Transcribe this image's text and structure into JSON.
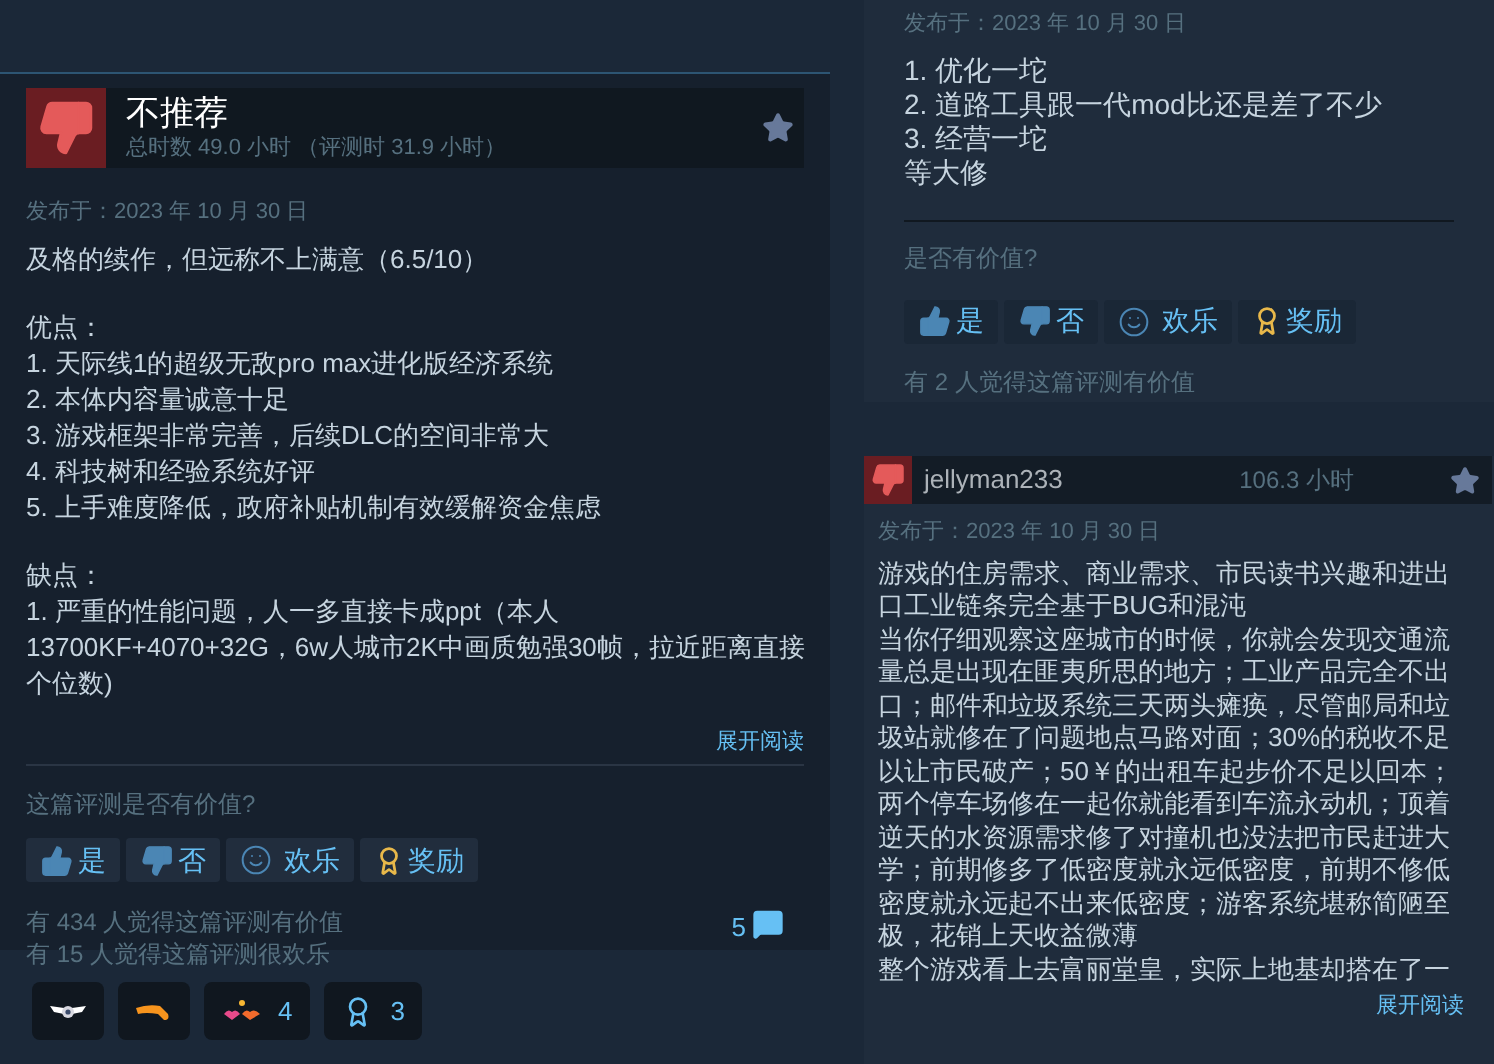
{
  "left_review": {
    "recommended": false,
    "title": "不推荐",
    "playtime": "总时数 49.0 小时 （评测时 31.9 小时）",
    "posted": "发布于：2023 年 10 月 30 日",
    "sections": [
      [
        "及格的续作，但远称不上满意（6.5/10）"
      ],
      [
        "优点：",
        "1. 天际线1的超级无敌pro max进化版经济系统",
        "2. 本体内容量诚意十足",
        "3. 游戏框架非常完善，后续DLC的空间非常大",
        "4. 科技树和经验系统好评",
        "5. 上手难度降低，政府补贴机制有效缓解资金焦虑"
      ],
      [
        "缺点：",
        "1. 严重的性能问题，人一多直接卡成ppt（本人13700KF+4070+32G，6w人城市2K中画质勉强30帧，拉近距离直接个位数)"
      ]
    ],
    "read_more": "展开阅读",
    "helpful_prompt": "这篇评测是否有价值?",
    "vote_buttons": [
      {
        "kind": "yes",
        "label": "是"
      },
      {
        "kind": "no",
        "label": "否"
      },
      {
        "kind": "funny",
        "label": "欢乐"
      },
      {
        "kind": "award",
        "label": "奖励"
      }
    ],
    "stats": [
      "有 434 人觉得这篇评测有价值",
      "有 15 人觉得这篇评测很欢乐"
    ],
    "comments": "5",
    "awards": [
      {
        "kind": "wings"
      },
      {
        "kind": "horn"
      },
      {
        "kind": "hearts",
        "count": "4"
      },
      {
        "kind": "ribbon",
        "count": "3"
      }
    ]
  },
  "right_top_review": {
    "posted": "发布于：2023 年 10 月 30 日",
    "lines": [
      "1. 优化一坨",
      "2. 道路工具跟一代mod比还是差了不少",
      "3. 经营一坨",
      "等大修"
    ],
    "helpful_prompt": "是否有价值?",
    "vote_buttons": [
      {
        "kind": "yes",
        "label": "是"
      },
      {
        "kind": "no",
        "label": "否"
      },
      {
        "kind": "funny",
        "label": "欢乐"
      },
      {
        "kind": "award",
        "label": "奖励"
      }
    ],
    "stats": [
      "有 2 人觉得这篇评测有价值"
    ]
  },
  "right_bottom_review": {
    "recommended": false,
    "author": "jellyman233",
    "hours": "106.3 小时",
    "posted": "发布于：2023 年 10 月 30 日",
    "paragraphs": [
      "游戏的住房需求、商业需求、市民读书兴趣和进出口工业链条完全基于BUG和混沌",
      "当你仔细观察这座城市的时候，你就会发现交通流量总是出现在匪夷所思的地方；工业产品完全不出口；邮件和垃圾系统三天两头瘫痪，尽管邮局和垃圾站就修在了问题地点马路对面；30%的税收不足以让市民破产；50￥的出租车起步价不足以回本；两个停车场修在一起你就能看到车流永动机；顶着逆天的水资源需求修了对撞机也没法把市民赶进大学；前期修多了低密度就永远低密度，前期不修低密度就永远起不出来低密度；游客系统堪称简陋至极，花销上天收益微薄",
      "整个游戏看上去富丽堂皇，实际上地基却搭在了一"
    ],
    "read_more": "展开阅读"
  }
}
